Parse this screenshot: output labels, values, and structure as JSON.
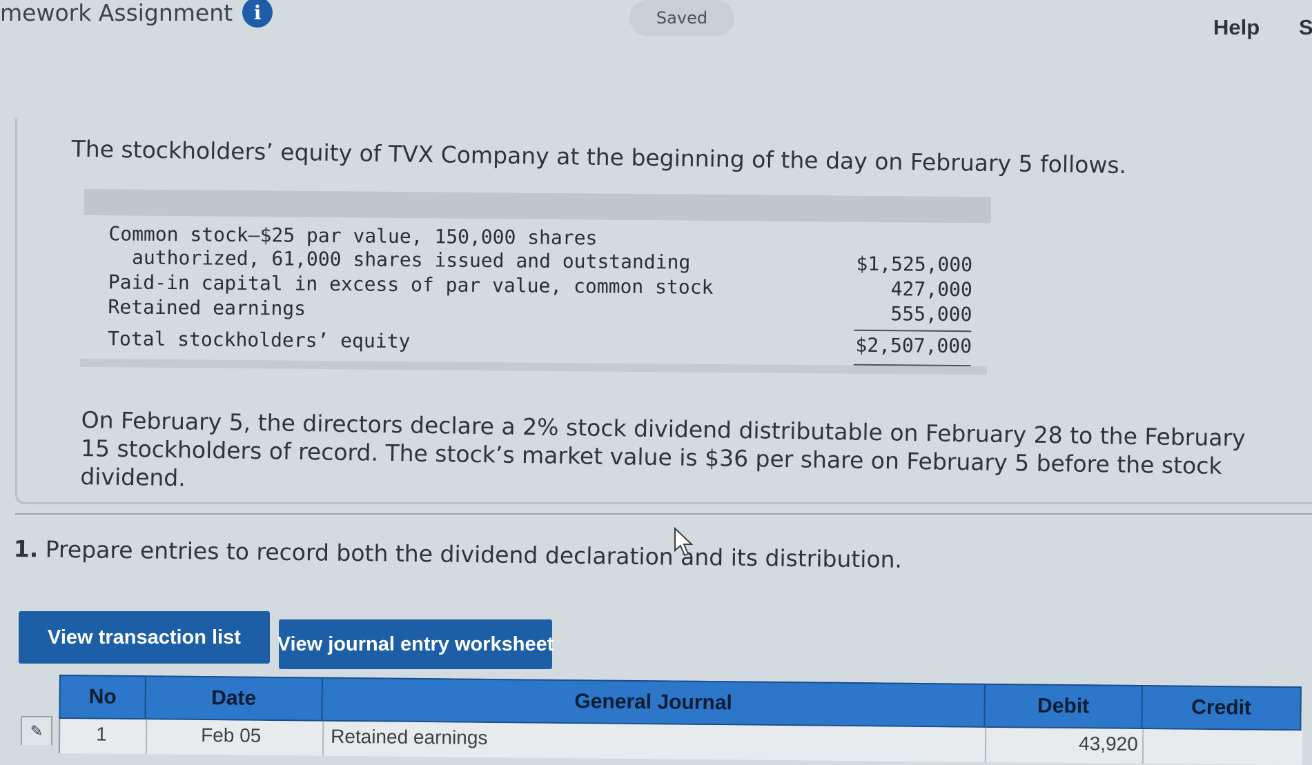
{
  "header": {
    "title": "mework Assignment",
    "info_icon": "i",
    "saved_label": "Saved",
    "help_label": "Help",
    "cut_label": "S"
  },
  "problem": {
    "intro": "The stockholders’ equity of TVX Company at the beginning of the day on February 5 follows.",
    "equity_rows": [
      {
        "label_line1": "Common stock—$25 par value, 150,000 shares",
        "label_line2": "authorized, 61,000 shares issued and outstanding",
        "value": "$1,525,000"
      },
      {
        "label": "Paid-in capital in excess of par value, common stock",
        "value": "427,000"
      },
      {
        "label": "Retained earnings",
        "value": "555,000"
      },
      {
        "label": "Total stockholders’ equity",
        "value": "$2,507,000"
      }
    ],
    "dividend_text": "On February 5, the directors declare a 2% stock dividend distributable on February 28 to the February 15 stockholders of record. The stock’s market value is $36 per share on February 5 before the stock dividend."
  },
  "question": {
    "number": "1.",
    "text": "Prepare entries to record both the dividend declaration and its distribution."
  },
  "buttons": {
    "transaction_list": "View transaction list",
    "journal_worksheet": "View journal entry worksheet"
  },
  "journal": {
    "columns": {
      "no": "No",
      "date": "Date",
      "general_journal": "General Journal",
      "debit": "Debit",
      "credit": "Credit"
    },
    "rows": [
      {
        "no": "1",
        "date": "Feb 05",
        "account": "Retained earnings",
        "debit": "43,920"
      }
    ]
  },
  "colors": {
    "accent": "#1d5fa6",
    "table_header": "#2c77c9",
    "background": "#d4dbe0"
  },
  "icons": {
    "info": "info-icon",
    "cursor": "mouse-pointer-icon",
    "edit": "pencil-icon"
  }
}
